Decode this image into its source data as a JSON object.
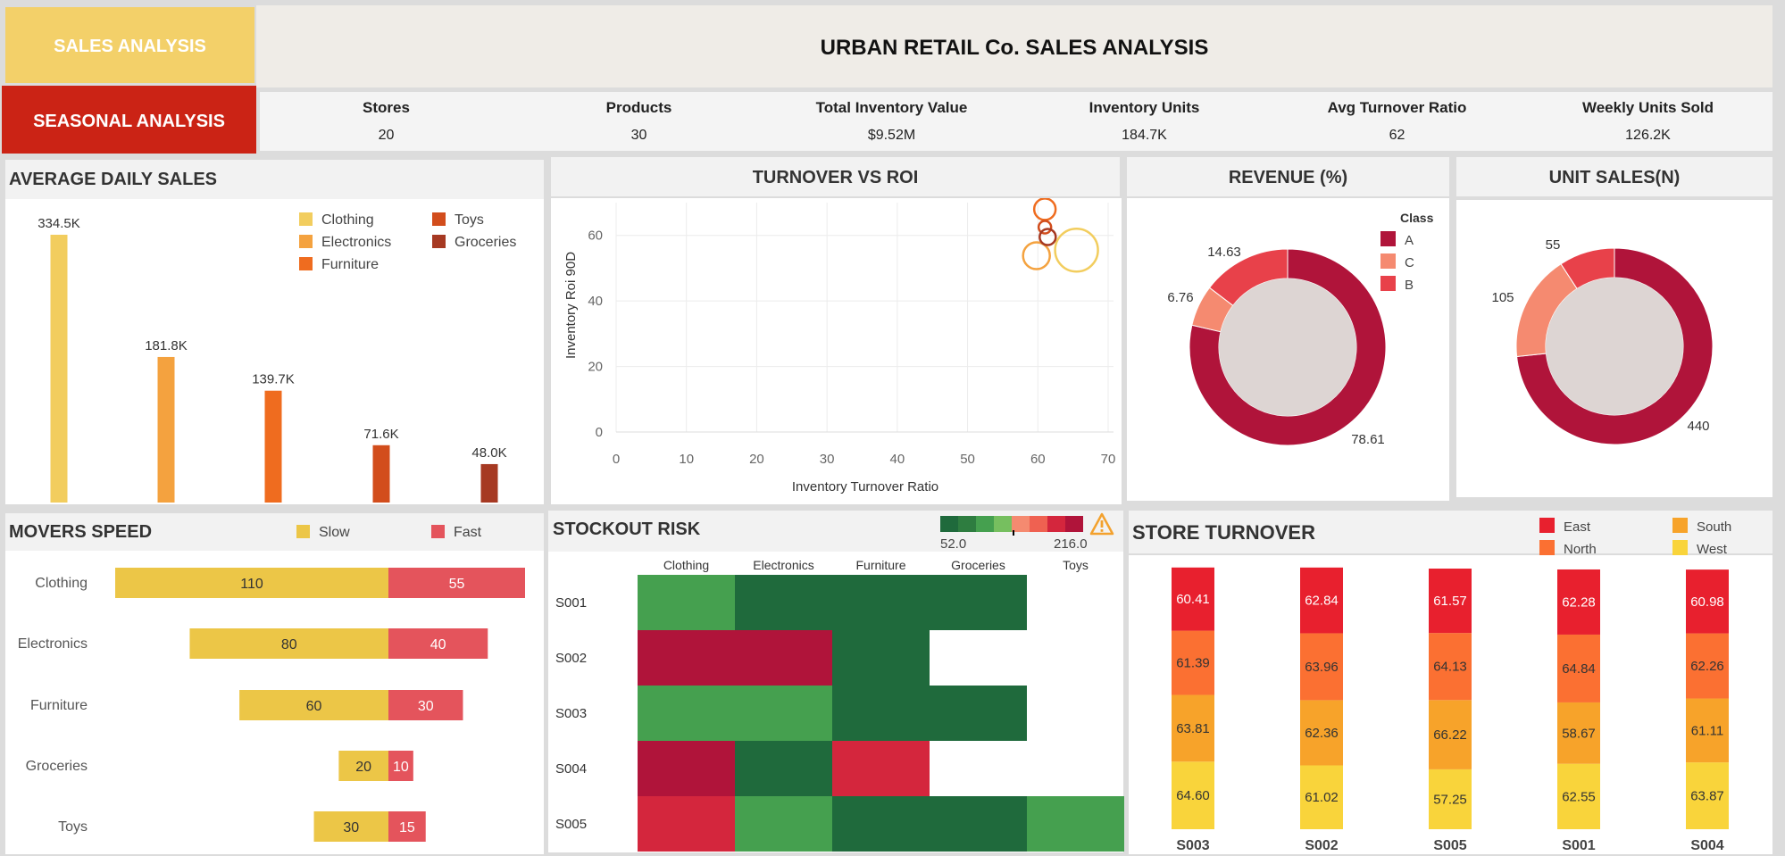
{
  "nav": {
    "sales_label": "SALES ANALYSIS",
    "seasonal_label": "SEASONAL ANALYSIS"
  },
  "header": {
    "title": "URBAN RETAIL Co. SALES ANALYSIS"
  },
  "kpis": [
    {
      "label": "Stores",
      "value": "20"
    },
    {
      "label": "Products",
      "value": "30"
    },
    {
      "label": "Total Inventory Value",
      "value": "$9.52M"
    },
    {
      "label": "Inventory Units",
      "value": "184.7K"
    },
    {
      "label": "Avg Turnover Ratio",
      "value": "62"
    },
    {
      "label": "Weekly Units Sold",
      "value": "126.2K"
    }
  ],
  "colors": {
    "Clothing": "#f2cd5e",
    "Electronics": "#f4a23f",
    "Furniture": "#ef6c1f",
    "Toys": "#d24d1c",
    "Groceries": "#a63922",
    "Slow": "#ecc647",
    "Fast": "#e4545c",
    "ClassA": "#b0143a",
    "ClassC": "#f58a70",
    "ClassB": "#e8414a",
    "East": "#e8202e",
    "North": "#fb7032",
    "South": "#f7a32a",
    "West": "#f9d43b"
  },
  "avg_daily": {
    "title": "AVERAGE DAILY SALES",
    "legend": [
      "Clothing",
      "Electronics",
      "Furniture",
      "Toys",
      "Groceries"
    ],
    "chart_data": {
      "type": "bar",
      "categories": [
        "Clothing",
        "Electronics",
        "Furniture",
        "Toys",
        "Groceries"
      ],
      "values": [
        334.5,
        181.8,
        139.7,
        71.6,
        48.0
      ],
      "labels": [
        "334.5K",
        "181.8K",
        "139.7K",
        "71.6K",
        "48.0K"
      ]
    }
  },
  "turnover_roi": {
    "title": "TURNOVER VS ROI",
    "chart_data": {
      "type": "scatter",
      "xlabel": "Inventory Turnover Ratio",
      "ylabel": "Inventory Roi 90D",
      "xlim": [
        0,
        70
      ],
      "ylim": [
        0,
        70
      ],
      "xticks": [
        "0",
        "10",
        "20",
        "30",
        "40",
        "50",
        "60",
        "70"
      ],
      "yticks": [
        "0",
        "20",
        "40",
        "60"
      ],
      "points": [
        {
          "category": "Clothing",
          "x": 65.5,
          "y": 55.5,
          "size": 48.0
        },
        {
          "category": "Electronics",
          "x": 59.8,
          "y": 53.8,
          "size": 30.0
        },
        {
          "category": "Furniture",
          "x": 61.0,
          "y": 68.0,
          "size": 24.0
        },
        {
          "category": "Toys",
          "x": 61.0,
          "y": 62.5,
          "size": 14.0
        },
        {
          "category": "Groceries",
          "x": 61.4,
          "y": 59.5,
          "size": 18.0
        }
      ]
    }
  },
  "revenue": {
    "title": "REVENUE (%)",
    "legend_title": "Class",
    "legend": [
      "A",
      "C",
      "B"
    ],
    "chart_data": {
      "type": "pie",
      "labels": [
        "A",
        "C",
        "B"
      ],
      "values": [
        78.61,
        6.76,
        14.63
      ],
      "value_labels": [
        "78.61",
        "6.76",
        "14.63"
      ]
    }
  },
  "unit_sales": {
    "title": "UNIT SALES(N)",
    "chart_data": {
      "type": "pie",
      "labels": [
        "A",
        "C",
        "B"
      ],
      "values": [
        440,
        105,
        55
      ],
      "value_labels": [
        "440",
        "105",
        "55"
      ]
    }
  },
  "movers": {
    "title": "MOVERS SPEED",
    "legend": [
      "Slow",
      "Fast"
    ],
    "chart_data": {
      "type": "bar",
      "categories": [
        "Clothing",
        "Electronics",
        "Furniture",
        "Groceries",
        "Toys"
      ],
      "series": [
        {
          "name": "Slow",
          "values": [
            110,
            80,
            60,
            20,
            30
          ]
        },
        {
          "name": "Fast",
          "values": [
            55,
            40,
            30,
            10,
            15
          ]
        }
      ]
    }
  },
  "stockout": {
    "title": "STOCKOUT RISK",
    "legend_min": "52.0",
    "legend_max": "216.0",
    "warning_icon": "warning-icon",
    "chart_data": {
      "type": "heatmap",
      "columns": [
        "Clothing",
        "Electronics",
        "Furniture",
        "Groceries",
        "Toys"
      ],
      "rows": [
        "S001",
        "S002",
        "S003",
        "S004",
        "S005"
      ],
      "palette": [
        "#1f6a3c",
        "#2e7d40",
        "#45a04f",
        "#76bf5f",
        "#f58a70",
        "#ef6151",
        "#d4263d",
        "#b0143a"
      ],
      "values": [
        [
          95,
          60,
          60,
          60,
          null
        ],
        [
          205,
          205,
          60,
          null,
          null
        ],
        [
          100,
          100,
          60,
          60,
          null
        ],
        [
          205,
          60,
          175,
          null,
          null
        ],
        [
          175,
          100,
          60,
          60,
          100
        ]
      ]
    }
  },
  "store_turnover": {
    "title": "STORE TURNOVER",
    "legend": [
      "East",
      "North",
      "South",
      "West"
    ],
    "chart_data": {
      "type": "bar",
      "stacked": true,
      "categories": [
        "S003",
        "S002",
        "S005",
        "S001",
        "S004"
      ],
      "series": [
        {
          "name": "West",
          "values": [
            64.6,
            61.02,
            57.25,
            62.55,
            63.87
          ]
        },
        {
          "name": "South",
          "values": [
            63.81,
            62.36,
            66.22,
            58.67,
            61.11
          ]
        },
        {
          "name": "North",
          "values": [
            61.39,
            63.96,
            64.13,
            64.84,
            62.26
          ]
        },
        {
          "name": "East",
          "values": [
            60.41,
            62.84,
            61.57,
            62.28,
            60.98
          ]
        }
      ]
    }
  }
}
